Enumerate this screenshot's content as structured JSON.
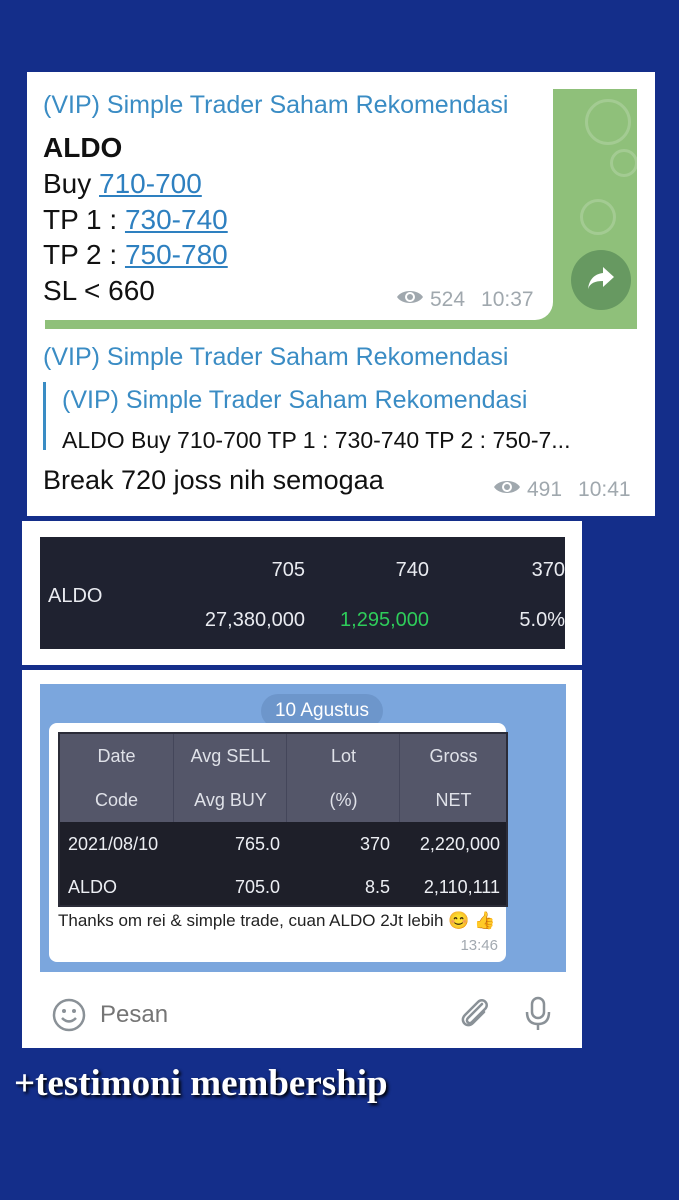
{
  "post1": {
    "channel_name": "(VIP) Simple Trader Saham Rekomendasi",
    "ticker": "ALDO",
    "buy_label": "Buy ",
    "buy_value": "710-700",
    "tp1_label": "TP 1 : ",
    "tp1_value": "730-740",
    "tp2_label": "TP 2 : ",
    "tp2_value": "750-780",
    "sl_line": "SL < 660",
    "views": "524",
    "time": "10:37"
  },
  "post2": {
    "channel_name": "(VIP) Simple Trader Saham Rekomendasi",
    "quote_channel": "(VIP) Simple Trader Saham Rekomendasi",
    "quote_text": "ALDO Buy 710-700 TP 1 : 730-740 TP 2 : 750-7...",
    "message": "Break 720 joss nih semogaa",
    "views": "491",
    "time": "10:41"
  },
  "portfolio": {
    "code": "ALDO",
    "avg_buy": "705",
    "last": "740",
    "lot": "370",
    "value": "27,380,000",
    "pl": "1,295,000",
    "pct": "5.0%"
  },
  "testimonial": {
    "date_pill": "10 Agustus",
    "headers_row1": [
      "Date",
      "Avg SELL",
      "Lot",
      "Gross"
    ],
    "headers_row2": [
      "Code",
      "Avg BUY",
      "(%)",
      "NET"
    ],
    "row1": {
      "date": "2021/08/10",
      "avg_sell": "765.0",
      "lot": "370",
      "gross": "2,220,000"
    },
    "row2": {
      "code": "ALDO",
      "avg_buy": "705.0",
      "pct": "8.5",
      "net": "2,110,111"
    },
    "caption": "Thanks om rei & simple trade, cuan ALDO 2Jt lebih 😊 👍",
    "time": "13:46"
  },
  "input": {
    "placeholder": "Pesan"
  },
  "footer_caption": "+testimoni membership",
  "colors": {
    "background": "#142e8a",
    "link": "#2e80c0",
    "channel": "#3a8cc4",
    "profit_green": "#2ecc5a",
    "dark_table": "#1f2230",
    "chat_bg": "#7ba6dd"
  },
  "icons": [
    "eye-icon",
    "forward-icon",
    "smile-icon",
    "attach-icon",
    "mic-icon"
  ]
}
